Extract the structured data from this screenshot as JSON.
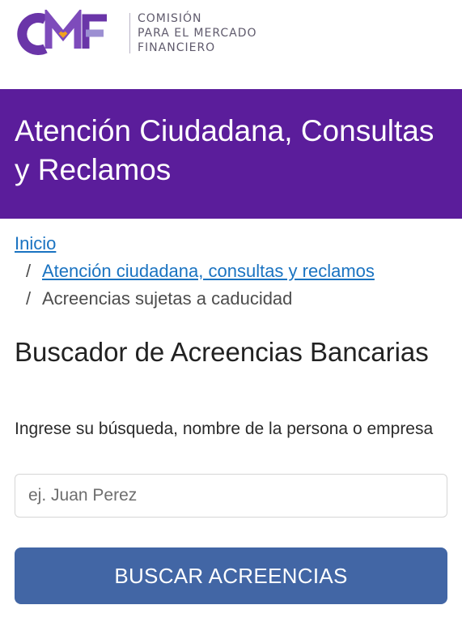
{
  "header": {
    "logo_lines": [
      "Comisión",
      "para el Mercado",
      "Financiero"
    ],
    "logo_colors": {
      "purple": "#6a35a8",
      "orange": "#f0a21e",
      "lavender": "#9c8fd2"
    }
  },
  "banner": {
    "title": "Atención Ciudadana, Consultas y Reclamos",
    "background": "#5b1d9b"
  },
  "breadcrumb": {
    "separator": "/",
    "items": [
      {
        "label": "Inicio",
        "link": true
      },
      {
        "label": "Atención ciudadana, consultas y reclamos",
        "link": true
      },
      {
        "label": "Acreencias sujetas a caducidad",
        "link": false
      }
    ]
  },
  "search": {
    "title": "Buscador de Acreencias Bancarias",
    "label": "Ingrese su búsqueda, nombre de la persona o empresa",
    "value": "",
    "placeholder": "ej. Juan Perez",
    "button_label": "BUSCAR ACREENCIAS",
    "button_color": "#4266a5"
  }
}
